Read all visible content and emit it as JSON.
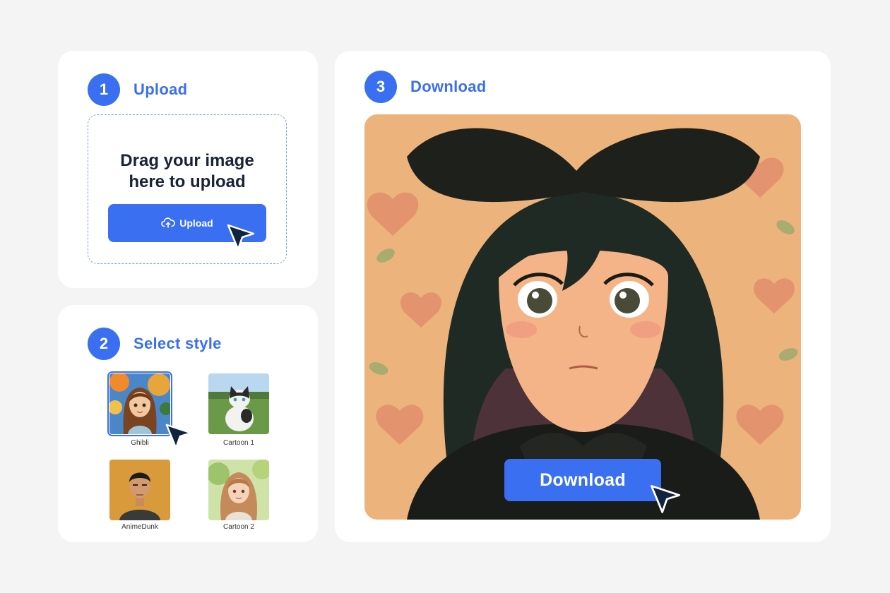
{
  "steps": [
    {
      "number": "1",
      "title": "Upload"
    },
    {
      "number": "2",
      "title": "Select style"
    },
    {
      "number": "3",
      "title": "Download"
    }
  ],
  "upload": {
    "drop_text": "Drag  your image\nhere to upload",
    "button_label": "Upload",
    "button_icon": "cloud-upload-icon"
  },
  "styles": [
    {
      "label": "Ghibli",
      "selected": true
    },
    {
      "label": "Cartoon 1",
      "selected": false
    },
    {
      "label": "AnimeDunk",
      "selected": false
    },
    {
      "label": "Cartoon 2",
      "selected": false
    }
  ],
  "download": {
    "button_label": "Download"
  },
  "colors": {
    "accent": "#3a6ff2",
    "background": "#f4f4f5",
    "card": "#ffffff",
    "text_dark": "#1a2238"
  }
}
